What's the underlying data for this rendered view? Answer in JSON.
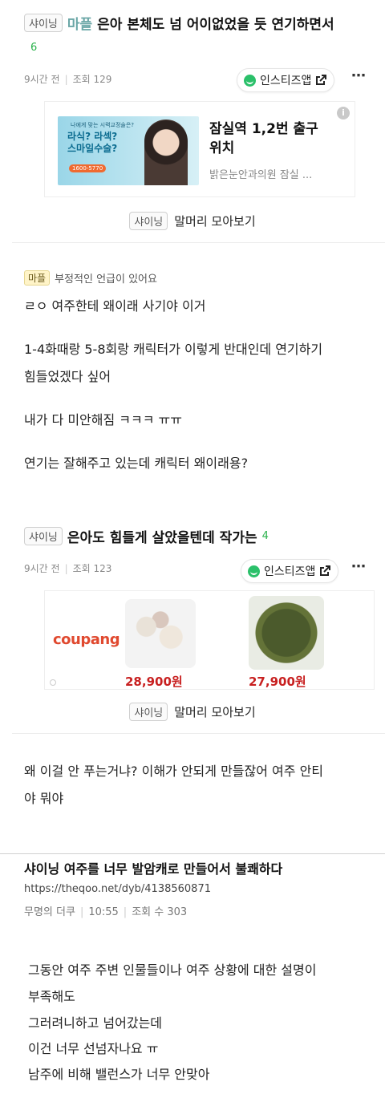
{
  "post1": {
    "tag": "샤이닝",
    "prefix": "마플",
    "title": "은아 본체도 넘 어이없었을 듯 연기하면서",
    "count": "6",
    "time": "9시간 전",
    "views": "조회 129",
    "app_label": "인스티즈앱",
    "ad": {
      "title": "잠실역 1,2번 출구 위치",
      "subtitle": "밝은눈안과의원 잠실 ...",
      "banner_top": "나에게 맞는 시력교정술은?",
      "banner_main": "라식? 라섹? 스마일수술?",
      "banner_phone": "1600-5770"
    },
    "collect_tag": "샤이닝",
    "collect_label": "말머리 모아보기",
    "note_tag": "마플",
    "note": "부정적인 언급이 있어요",
    "lines": [
      "ㄹㅇ 여주한테 왜이래 사기야 이거",
      "1-4화때랑 5-8회랑 캐릭터가 이렇게 반대인데 연기하기",
      "힘들었겠다 싶어",
      "내가 다 미안해짐 ㅋㅋㅋ ㅠㅠ",
      "연기는 잘해주고 있는데 캐릭터 왜이래용?"
    ]
  },
  "post2": {
    "tag": "샤이닝",
    "title": "은아도 힘들게 살았을텐데 작가는",
    "count": "4",
    "time": "9시간 전",
    "views": "조회 123",
    "app_label": "인스티즈앱",
    "ad": {
      "brand": "coupang",
      "price1": "28,900원",
      "price2": "27,900원"
    },
    "collect_tag": "샤이닝",
    "collect_label": "말머리 모아보기",
    "lines": [
      "왜 이걸 안 푸는거냐? 이해가 안되게 만들잖어 여주 안티",
      "야 뭐야"
    ]
  },
  "post3": {
    "title": "샤이닝 여주를 너무 발암캐로 만들어서 불쾌하다",
    "url": "https://theqoo.net/dyb/4138560871",
    "author": "무명의 더쿠",
    "time": "10:55",
    "views": "조회 수 303",
    "lines": [
      "그동안 여주 주변 인물들이나 여주 상황에 대한 설명이",
      "부족해도",
      "그러려니하고 넘어갔는데",
      "이건 너무 선넘자나요 ㅠ",
      "남주에 비해 밸런스가 너무 안맞아"
    ]
  },
  "colors": {
    "accent_green": "#2bb24c",
    "price_red": "#c82020",
    "coupang_red": "#e0492f"
  },
  "icons": [
    "instiz-smile-icon",
    "external-link-icon",
    "more-dots-icon",
    "info-icon",
    "ad-logo-icon"
  ]
}
